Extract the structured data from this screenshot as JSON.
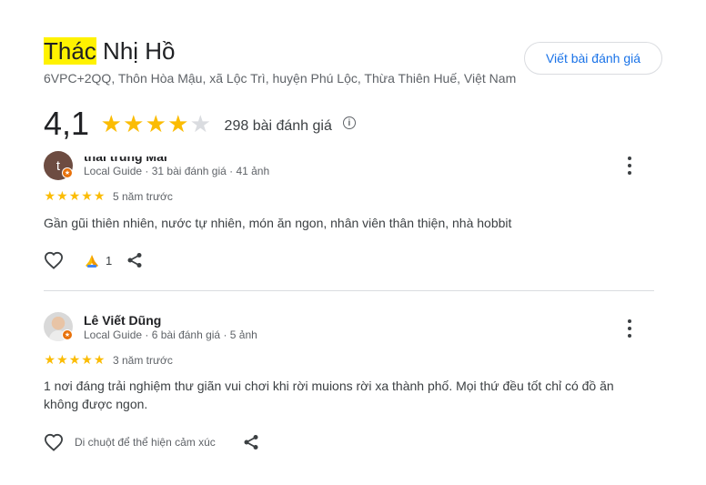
{
  "place": {
    "title_highlight": "Thác",
    "title_rest": " Nhị Hồ",
    "address": "6VPC+2QQ, Thôn Hòa Mậu, xã Lộc Trì, huyện Phú Lộc, Thừa Thiên Huế, Việt Nam",
    "write_review_label": "Viết bài đánh giá",
    "rating": "4,1",
    "rating_value": 4.1,
    "review_count": "298 bài đánh giá",
    "info_icon": "i",
    "star_color": "#fbbc04"
  },
  "reviews": [
    {
      "avatar_letter": "t",
      "name": "thái trung Mai",
      "meta": "Local Guide · 31 bài đánh giá · 41 ảnh",
      "stars": 5,
      "ago": "5 năm trước",
      "text": "Gần gũi thiên nhiên, nước tự nhiên, món ăn ngon, nhân viên thân thiện, nhà hobbit",
      "reaction_count": "1"
    },
    {
      "name": "Lê Viết Dũng",
      "meta": "Local Guide · 6 bài đánh giá · 5 ảnh",
      "stars": 5,
      "ago": "3 năm trước",
      "text": "1 nơi đáng trải nghiệm thư giãn vui chơi khi rời muions rời xa thành phố. Mọi thứ đều tốt chỉ có đồ ăn không được ngon.",
      "hover_hint": "Di chuột để thể hiện cảm xúc"
    }
  ]
}
